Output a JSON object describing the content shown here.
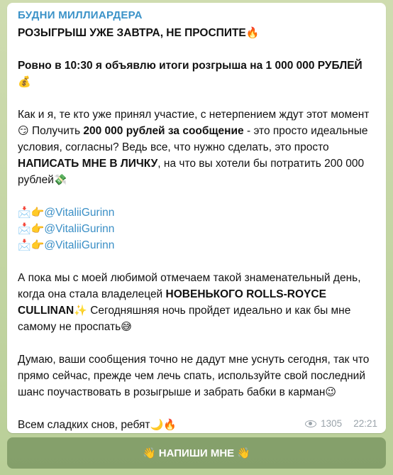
{
  "post": {
    "channel_name": "БУДНИ МИЛЛИАРДЕРА",
    "headline": "РОЗЫГРЫШ УЖЕ ЗАВТРА, НЕ ПРОСПИТЕ",
    "headline_emoji": "🔥",
    "announcement": "Ровно в 10:30 я объявлю итоги розгрыша на 1 000 000 РУБЛЕЙ",
    "announcement_emoji": "💰",
    "p1_a": "Как и я, те кто уже принял участие, с нетерпением ждут этот момент",
    "p1_emoji1": "😏",
    "p1_b": " Получить ",
    "p1_bold1": "200 000 рублей за сообщение",
    "p1_c": " - это просто идеальные условия, согласны? Ведь все, что нужно сделать, это просто ",
    "p1_bold2": "НАПИСАТЬ МНЕ В ЛИЧКУ",
    "p1_d": ", на что вы хотели бы потратить 200 000 рублей",
    "p1_emoji2": "💸",
    "links": [
      {
        "icon": "📩👉",
        "text": "@VitaliiGurinn"
      },
      {
        "icon": "📩👉",
        "text": "@VitaliiGurinn"
      },
      {
        "icon": "📩👉",
        "text": "@VitaliiGurinn"
      }
    ],
    "p2_a": "А пока мы с моей любимой отмечаем такой знаменательный день, когда она стала владелецей ",
    "p2_bold": "НОВЕНЬКОГО ROLLS-ROYCE CULLINAN",
    "p2_emoji1": "✨",
    "p2_b": " Сегодняшняя ночь пройдет идеально и как бы мне самому не проспать",
    "p2_emoji2": "😅",
    "p3": "Думаю, ваши сообщения точно не дадут мне уснуть сегодня, так что прямо сейчас, прежде чем лечь спать, используйте свой последний шанс поучаствовать в розыгрыше и забрать бабки в карман",
    "p3_emoji": "😉",
    "p4": "Всем сладких снов, ребят",
    "p4_emoji": "🌙🔥",
    "views": "1305",
    "time": "22:21"
  },
  "button": {
    "emoji_left": "👋",
    "label": "НАПИШИ МНЕ",
    "emoji_right": "👋"
  }
}
